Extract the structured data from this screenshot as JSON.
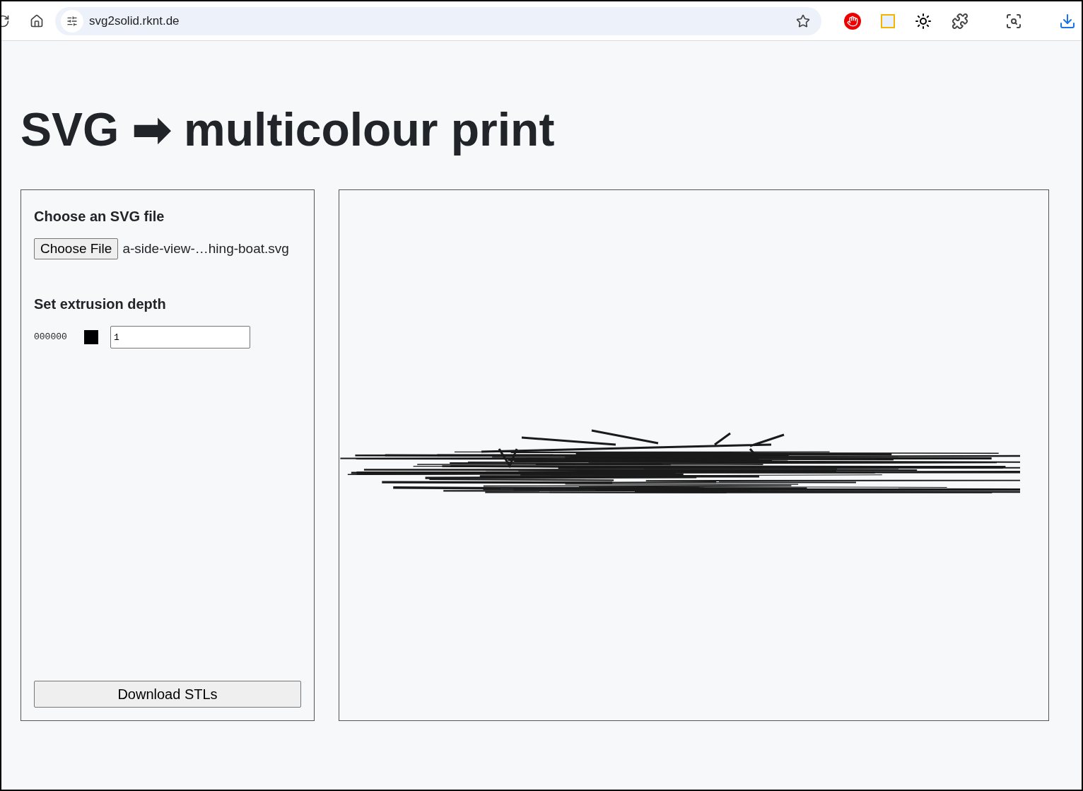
{
  "browser": {
    "url": "svg2solid.rknt.de"
  },
  "heading": {
    "left": "SVG",
    "arrow": "➡",
    "right": "multicolour print"
  },
  "controls": {
    "file_label": "Choose an SVG file",
    "file_button": "Choose File",
    "file_name": "a-side-view-…hing-boat.svg",
    "depth_label": "Set extrusion depth",
    "layers": [
      {
        "hex": "000000",
        "color": "#000000",
        "depth": "1"
      }
    ],
    "download_button": "Download STLs"
  }
}
